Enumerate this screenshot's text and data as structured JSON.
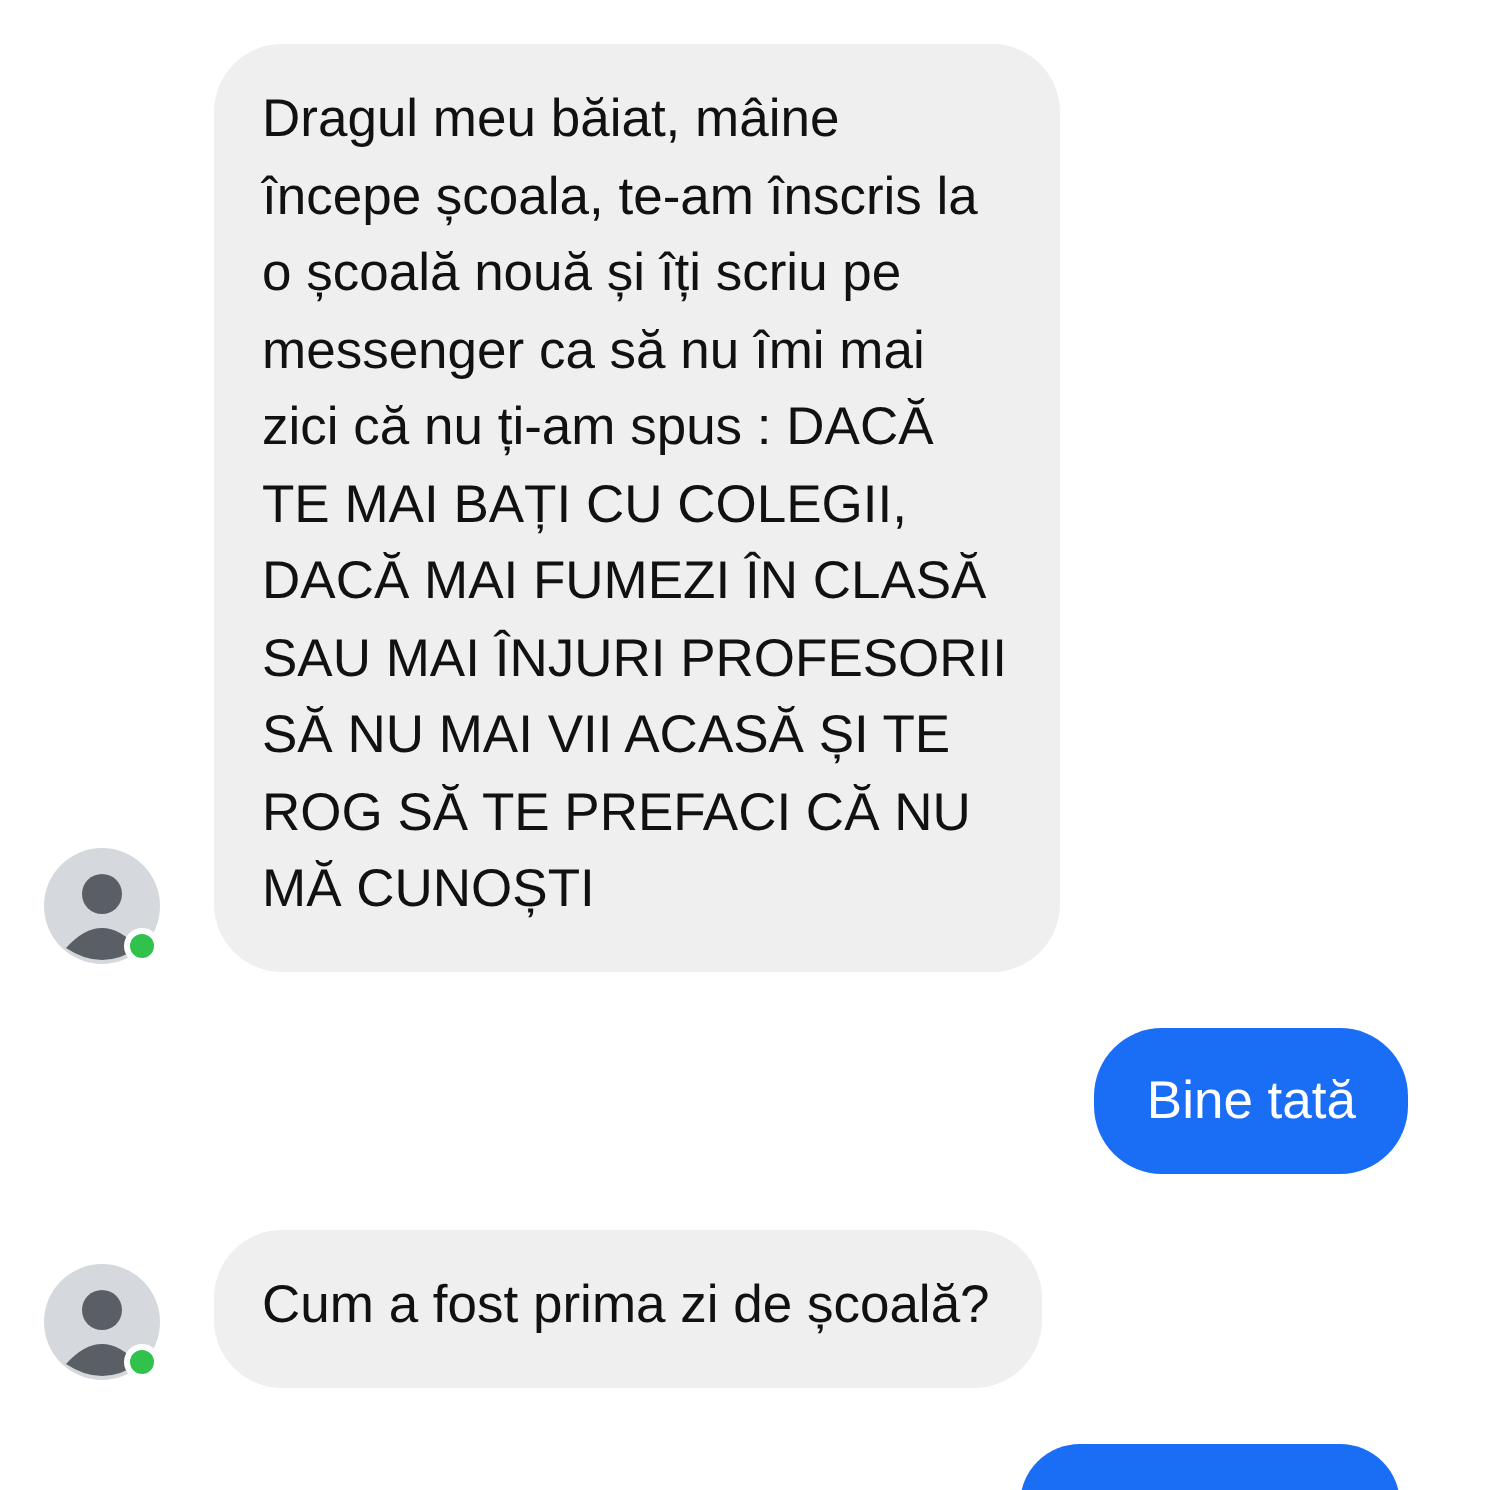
{
  "messages": [
    {
      "kind": "incoming",
      "avatar_online": true,
      "text": "Dragul meu băiat, mâine\nîncepe școala, te-am înscris la\no școală nouă și îți scriu pe\nmessenger ca să nu îmi mai\nzici că nu ți-am spus : DACĂ\nTE MAI BAȚI CU COLEGII,\nDACĂ MAI FUMEZI ÎN CLASĂ\nSAU MAI ÎNJURI PROFESORII\nSĂ NU MAI VII ACASĂ ȘI TE\nROG SĂ TE PREFACI CĂ NU\nMĂ CUNOȘTI"
    },
    {
      "kind": "outgoing",
      "text": "Bine tată"
    },
    {
      "kind": "incoming",
      "avatar_online": true,
      "text": "Cum a fost prima zi de școală?"
    },
    {
      "kind": "outgoing",
      "cut_off": true
    }
  ]
}
